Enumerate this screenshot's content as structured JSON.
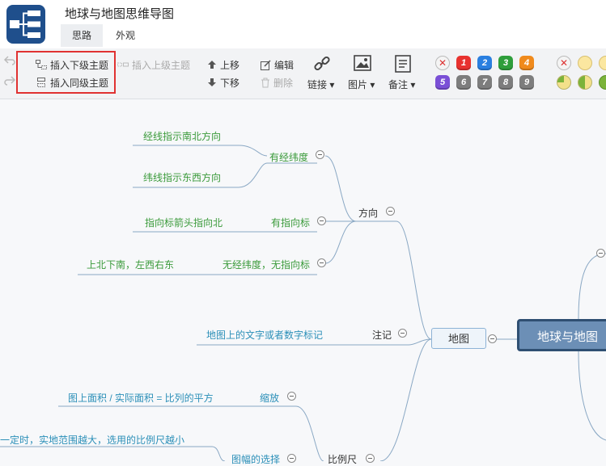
{
  "app": {
    "title": "地球与地图思维导图"
  },
  "tabs": [
    {
      "label": "思路"
    },
    {
      "label": "外观"
    }
  ],
  "toolbar": {
    "insert_child": "插入下级主题",
    "insert_parent": "插入上级主题",
    "insert_sibling": "插入同级主题",
    "move_up": "上移",
    "move_down": "下移",
    "edit": "编辑",
    "delete": "删除",
    "link": "链接",
    "image": "图片",
    "note": "备注",
    "priority": [
      "1",
      "2",
      "3",
      "4",
      "5",
      "6",
      "7",
      "8",
      "9"
    ],
    "priority_clear": "✕"
  },
  "colors": {
    "p1": "#e8322f",
    "p2": "#2a7fe0",
    "p3": "#2e9e3b",
    "p4": "#f08a1c",
    "p5": "#7a4fd6",
    "p6": "#7d7d7d",
    "p7": "#7d7d7d",
    "p8": "#7d7d7d",
    "p9": "#7d7d7d"
  },
  "mindmap": {
    "center": "地球与地图",
    "ditu": "地图",
    "fangxiang": "方向",
    "youjingweidu": "有经纬度",
    "jingxian": "经线指示南北方向",
    "weixian": "纬线指示东西方向",
    "youzhixiangbiao": "有指向标",
    "zhixiangbiao": "指向标箭头指向北",
    "wujingweidu": "无经纬度，无指向标",
    "shangbeixianan": "上北下南，左西右东",
    "zhuji": "注记",
    "zhujidesc": "地图上的文字或者数字标记",
    "suofang": "缩放",
    "suofangdesc": "图上面积 / 实际面积 = 比列的平方",
    "yidingshi": "一定时，实地范围越大，选用的比例尺越小",
    "tuxing": "图幅的选择",
    "bilichi": "比例尺"
  }
}
